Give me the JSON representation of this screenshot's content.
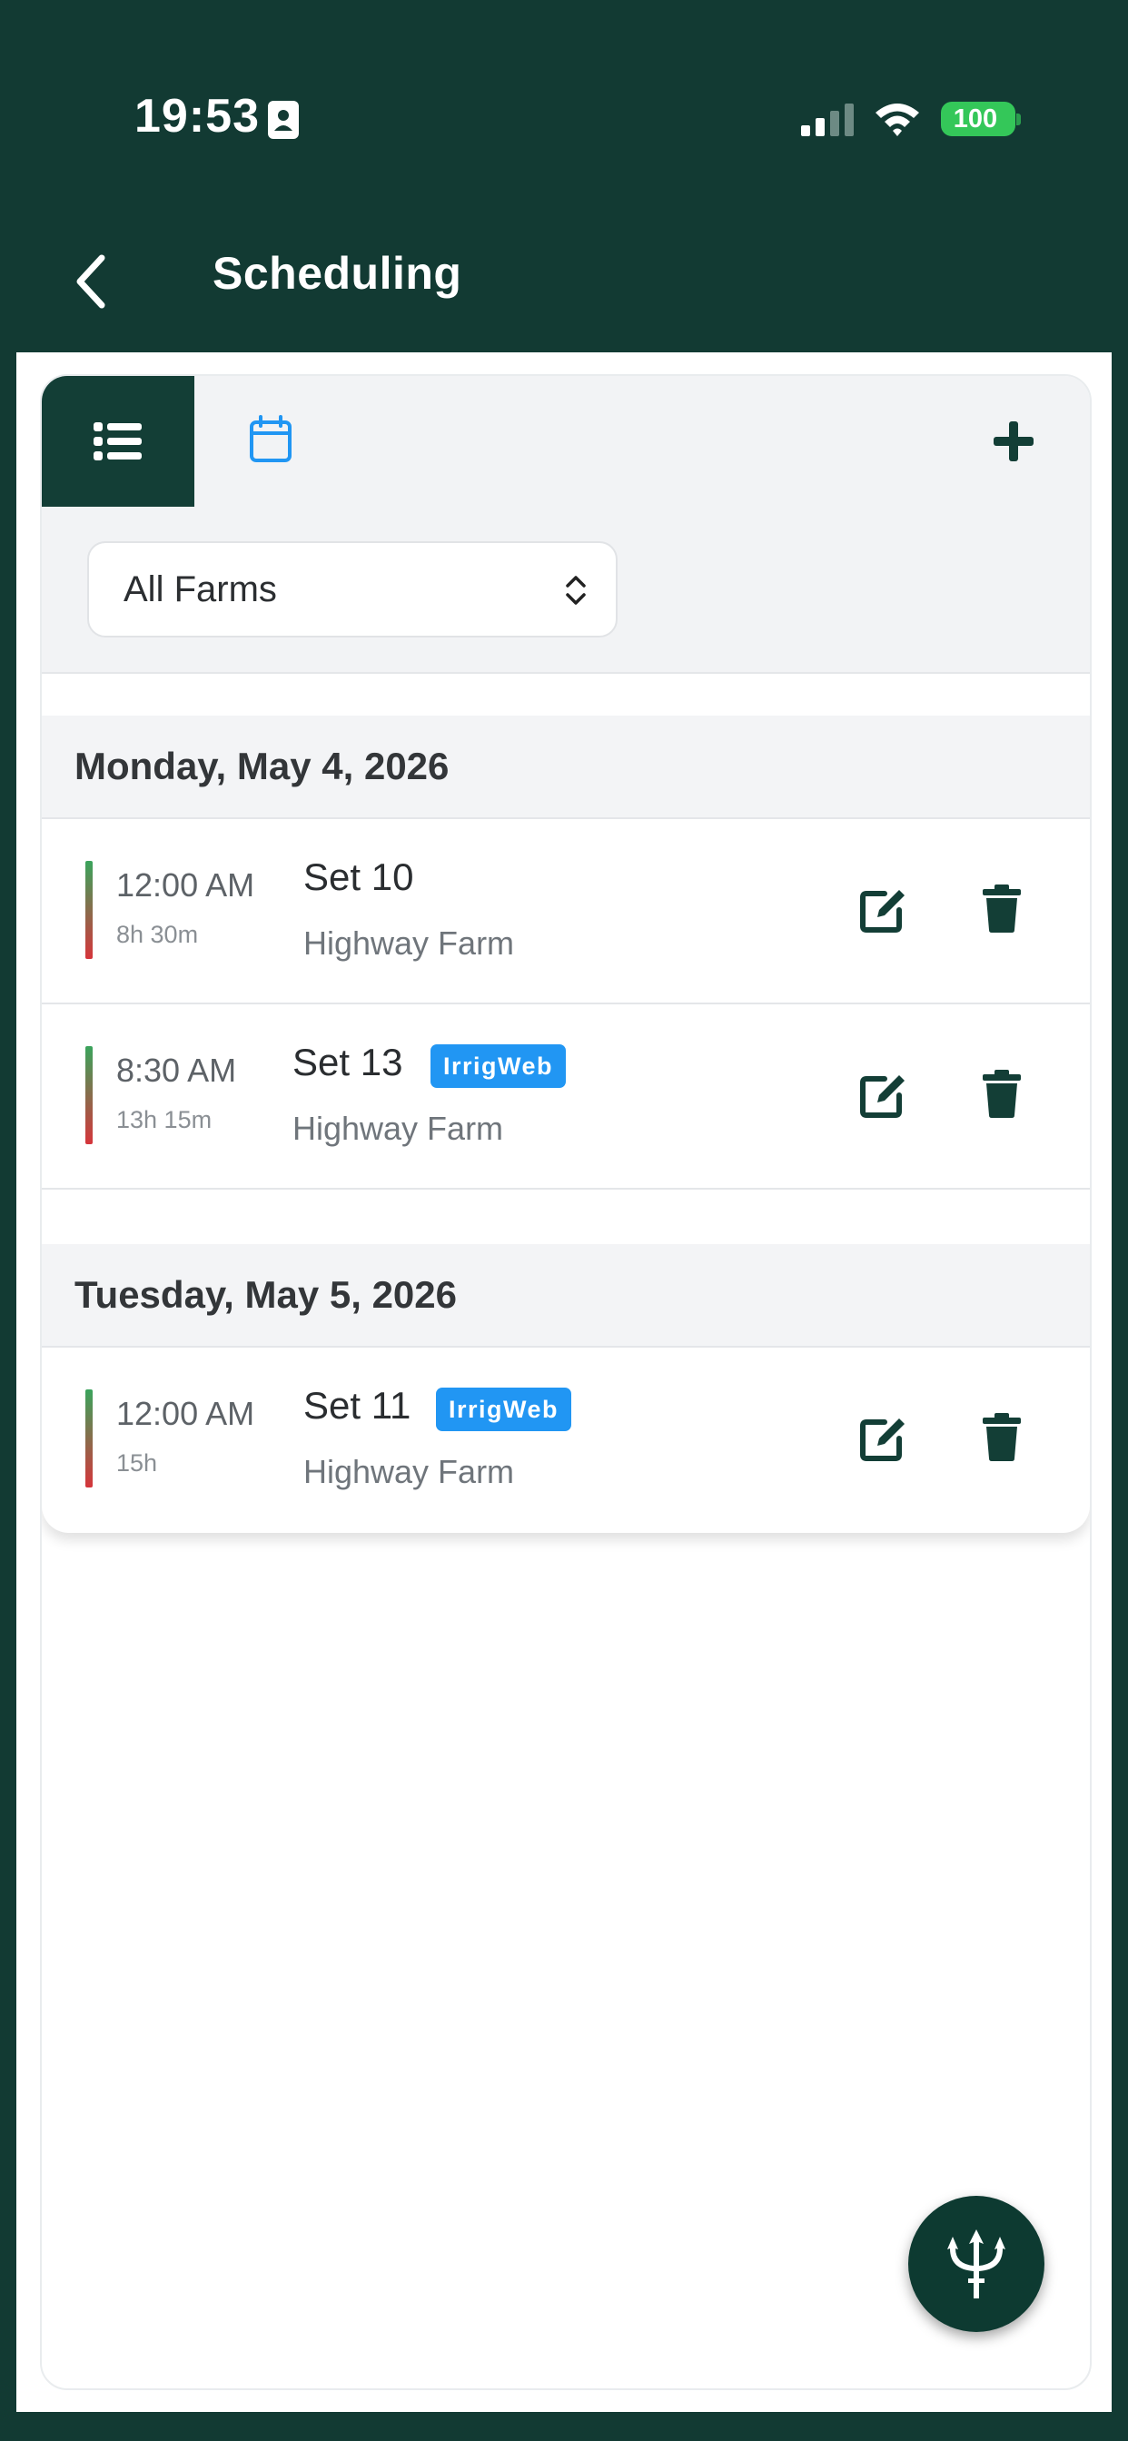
{
  "status_bar": {
    "time": "19:53",
    "battery": "100"
  },
  "nav": {
    "title": "Scheduling"
  },
  "tabs": {
    "list_icon": "list-icon",
    "calendar_icon": "calendar-icon",
    "add_icon": "plus-icon"
  },
  "filter": {
    "farm_selected": "All Farms"
  },
  "days": [
    {
      "title": "Monday, May 4, 2026",
      "entries": [
        {
          "time": "12:00 AM",
          "duration": "8h 30m",
          "name": "Set 10",
          "farm": "Highway Farm",
          "badge": ""
        },
        {
          "time": "8:30 AM",
          "duration": "13h 15m",
          "name": "Set 13",
          "farm": "Highway Farm",
          "badge": "IrrigWeb"
        }
      ]
    },
    {
      "title": "Tuesday, May 5, 2026",
      "entries": [
        {
          "time": "12:00 AM",
          "duration": "15h",
          "name": "Set 11",
          "farm": "Highway Farm",
          "badge": "IrrigWeb"
        }
      ]
    }
  ],
  "colors": {
    "brand_dark": "#123a33",
    "accent_blue": "#2196f3",
    "bar_top": "#3aa45c",
    "bar_bottom": "#d6353b",
    "battery_green": "#34c759"
  },
  "fab": {
    "icon": "trident-icon"
  }
}
